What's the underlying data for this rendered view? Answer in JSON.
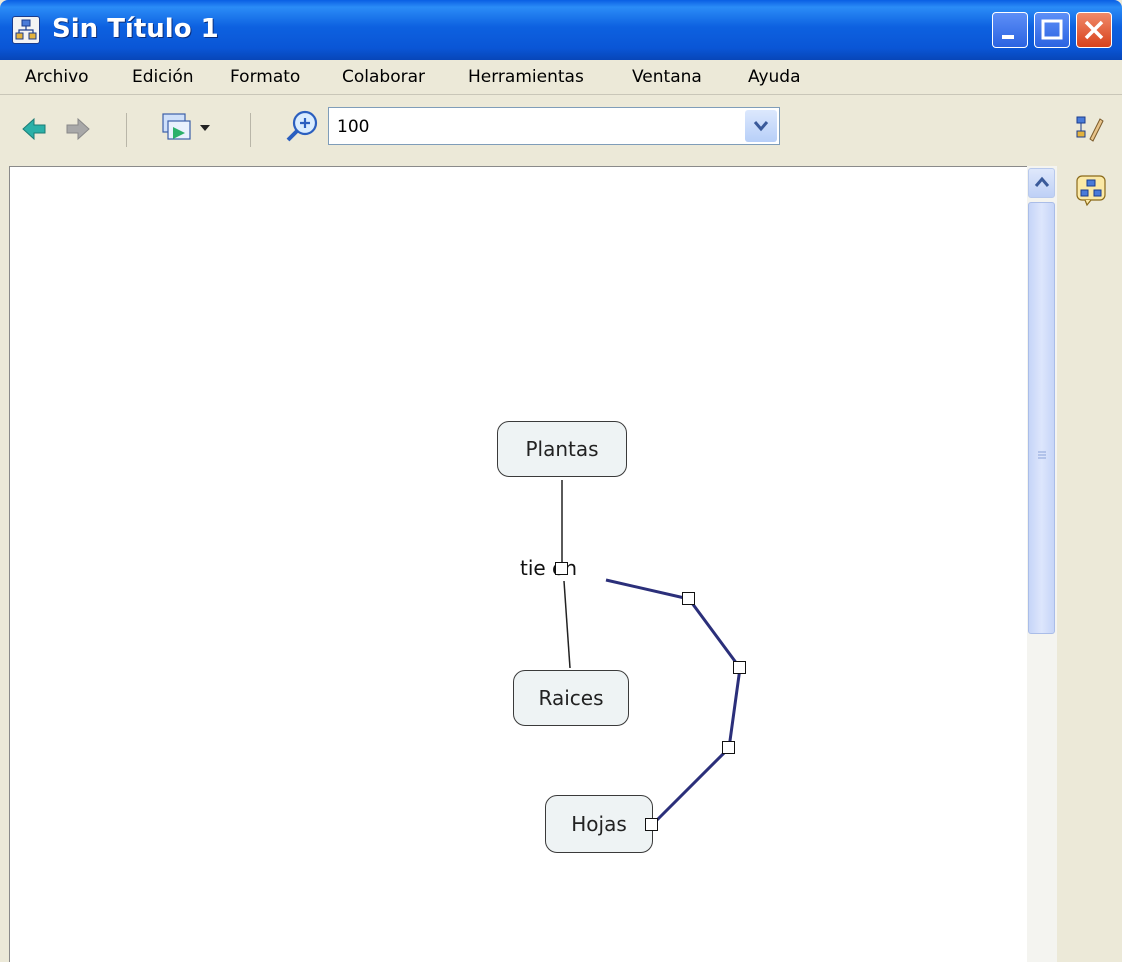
{
  "window": {
    "title": "Sin Título 1"
  },
  "menu": [
    "Archivo",
    "Edición",
    "Formato",
    "Colaborar",
    "Herramientas",
    "Ventana",
    "Ayuda"
  ],
  "toolbar": {
    "zoom_value": "100"
  },
  "map": {
    "concepts": [
      "Plantas",
      "Raices",
      "Hojas"
    ],
    "link_phrase": "tie en"
  },
  "colors": {
    "selected_link": "#2b2f7a",
    "node_fill": "#eef3f4"
  }
}
